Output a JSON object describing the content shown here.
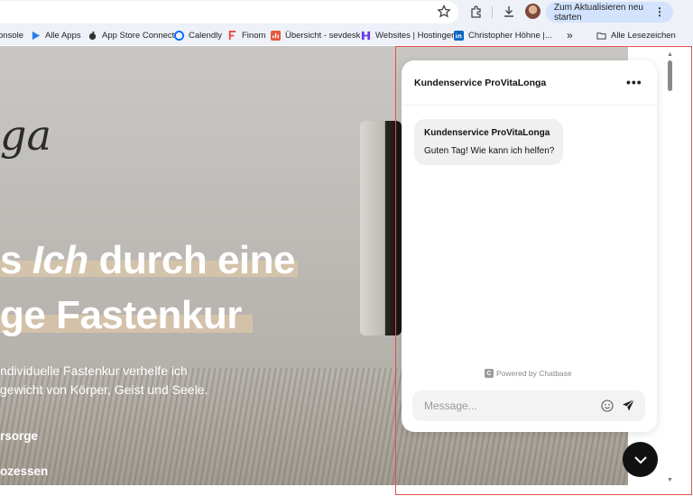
{
  "browser": {
    "update_button_label": "Zum Aktualisieren neu starten",
    "update_button_menu": "⋮",
    "icons": [
      "star-icon",
      "extensions-icon",
      "download-icon",
      "profile-avatar"
    ]
  },
  "bookmarks": {
    "items": [
      {
        "label": "onsole",
        "icon": "none"
      },
      {
        "label": "Alle Apps",
        "icon": "play-icon"
      },
      {
        "label": "App Store Connect",
        "icon": "apple-icon"
      },
      {
        "label": "Calendly",
        "icon": "calendly-icon"
      },
      {
        "label": "Finom",
        "icon": "finom-icon"
      },
      {
        "label": "Übersicht - sevdesk",
        "icon": "sevdesk-icon"
      },
      {
        "label": "Websites | Hostinger",
        "icon": "hostinger-icon"
      },
      {
        "label": "Christopher Höhne |...",
        "icon": "linkedin-icon"
      }
    ],
    "overflow_label": "»",
    "all_bookmarks_label": "Alle Lesezeichen"
  },
  "page": {
    "brand_script": "ga",
    "headline_line1_prefix": "s ",
    "headline_line1_em": "Ich",
    "headline_line1_suffix": " durch eine",
    "headline_line2": "ge Fastenkur",
    "subtext_line1": "ndividuelle Fastenkur verhelfe ich",
    "subtext_line2": "gewicht von Körper, Geist und Seele.",
    "link1": "rsorge",
    "link2": "ozessen"
  },
  "chat": {
    "title": "Kundenservice ProVitaLonga",
    "more_label": "•••",
    "message_sender": "Kundenservice ProVitaLonga",
    "message_text": "Guten Tag! Wie kann ich helfen?",
    "powered_by": "Powered by Chatbase",
    "input_placeholder": "Message..."
  },
  "colors": {
    "accent_band": "#d9c6a8",
    "update_button_bg": "#d3e3fd",
    "chat_toggle_bg": "#111111",
    "focus_frame": "#e05050"
  }
}
